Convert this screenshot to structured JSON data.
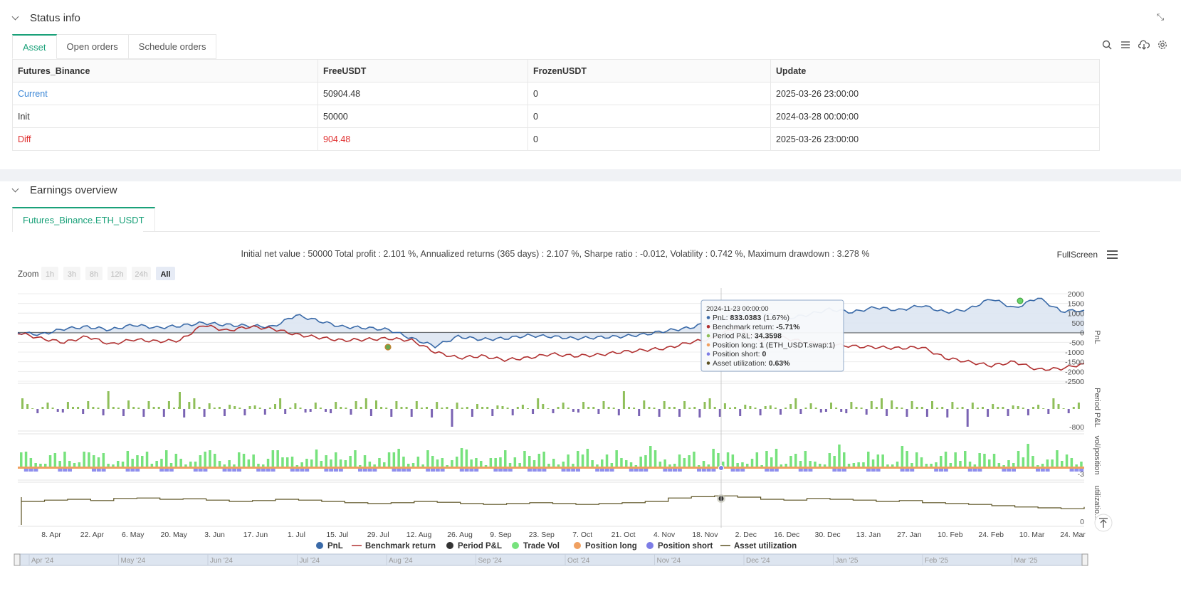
{
  "status_panel": {
    "title": "Status info",
    "tabs": [
      "Asset",
      "Open orders",
      "Schedule orders"
    ],
    "table": {
      "headers": [
        "Futures_Binance",
        "FreeUSDT",
        "FrozenUSDT",
        "Update"
      ],
      "rows": [
        [
          "Current",
          "50904.48",
          "0",
          "2025-03-26 23:00:00"
        ],
        [
          "Init",
          "50000",
          "0",
          "2024-03-28 00:00:00"
        ],
        [
          "Diff",
          "904.48",
          "0",
          "2025-03-26 23:00:00"
        ]
      ]
    }
  },
  "earnings_panel": {
    "title": "Earnings overview",
    "tab": "Futures_Binance.ETH_USDT",
    "summary": "Initial net value : 50000 Total profit : 2.101 %, Annualized returns (365 days) : 2.107 %, Sharpe ratio : -0.012, Volatility : 0.742 %, Maximum drawdown : 3.278 %",
    "fullscreen": "FullScreen",
    "zoom_label": "Zoom",
    "zoom_options": [
      "1h",
      "3h",
      "8h",
      "12h",
      "24h",
      "All"
    ],
    "zoom_selected": "All"
  },
  "chart_data": {
    "type": "line",
    "pnl_axis": {
      "ticks": [
        "2000",
        "1500",
        "1000",
        "500",
        "0",
        "-500",
        "-1000",
        "-1500",
        "-2000",
        "-2500"
      ],
      "label": "PnL",
      "ylim": [
        -2500,
        2000
      ]
    },
    "period_axis": {
      "label": "Period P&L",
      "tick": "-800"
    },
    "vol_axis": {
      "label": "vol/position",
      "tick": "-3"
    },
    "util_axis": {
      "label": "utilizatio...",
      "tick": "0"
    },
    "x_ticks": [
      "8. Apr",
      "22. Apr",
      "6. May",
      "20. May",
      "3. Jun",
      "17. Jun",
      "1. Jul",
      "15. Jul",
      "29. Jul",
      "12. Aug",
      "26. Aug",
      "9. Sep",
      "23. Sep",
      "7. Oct",
      "21. Oct",
      "4. Nov",
      "18. Nov",
      "2. Dec",
      "16. Dec",
      "30. Dec",
      "13. Jan",
      "27. Jan",
      "10. Feb",
      "24. Feb",
      "10. Mar",
      "24. Mar"
    ],
    "navigator_ticks": [
      "Apr '24",
      "May '24",
      "Jun '24",
      "Jul '24",
      "Aug '24",
      "Sep '24",
      "Oct '24",
      "Nov '24",
      "Dec '24",
      "Jan '25",
      "Feb '25",
      "Mar '25"
    ],
    "series": [
      {
        "name": "PnL",
        "color": "#3a6aa8",
        "values": [
          0,
          -100,
          200,
          300,
          150,
          400,
          250,
          350,
          500,
          400,
          350,
          300,
          900,
          600,
          300,
          250,
          150,
          -300,
          -700,
          -200,
          -350,
          -300,
          -150,
          -200,
          -300,
          -250,
          -200,
          -100,
          100,
          250,
          600,
          900,
          1100,
          700,
          900,
          1200,
          1050,
          1300,
          1150,
          1400,
          1050,
          1200,
          1750,
          1250,
          1800,
          1100,
          1150
        ]
      },
      {
        "name": "Benchmark return",
        "color": "#b03030",
        "values": [
          0,
          -300,
          -500,
          -200,
          -600,
          -350,
          -450,
          -400,
          400,
          100,
          300,
          200,
          -100,
          -250,
          -400,
          -350,
          -300,
          -400,
          -1000,
          -1300,
          -1200,
          -1400,
          -1300,
          -1100,
          -1200,
          -1150,
          -1000,
          -900,
          -800,
          -500,
          -300,
          300,
          -400,
          -250,
          -500,
          -600,
          -700,
          -750,
          -800,
          -750,
          -1300,
          -1500,
          -1700,
          -1500,
          -1900,
          -1850,
          -1600
        ]
      }
    ],
    "legend": [
      "PnL",
      "Benchmark return",
      "Period P&L",
      "Trade Vol",
      "Position long",
      "Position short",
      "Asset utilization"
    ],
    "legend_colors": [
      "#3a6aa8",
      "#b03030",
      "#333333",
      "#77e27d",
      "#f0a060",
      "#7d7de6",
      "#5a5020"
    ],
    "tooltip": {
      "date": "2024-11-23 00:00:00",
      "lines": [
        {
          "label": "PnL: ",
          "value": "833.0383",
          "extra": " (1.67%)",
          "color": "#3a6aa8"
        },
        {
          "label": "Benchmark return: ",
          "value": "-5.71%",
          "extra": "",
          "color": "#b03030"
        },
        {
          "label": "Period P&L: ",
          "value": "34.3598",
          "extra": "",
          "color": "#8fbf5a"
        },
        {
          "label": "Position long: ",
          "value": "1",
          "extra": " (ETH_USDT.swap:1)",
          "color": "#f0a060"
        },
        {
          "label": "Position short: ",
          "value": "0",
          "extra": "",
          "color": "#7d7de6"
        },
        {
          "label": "Asset utilization: ",
          "value": "0.63%",
          "extra": "",
          "color": "#5a5020"
        }
      ]
    }
  }
}
